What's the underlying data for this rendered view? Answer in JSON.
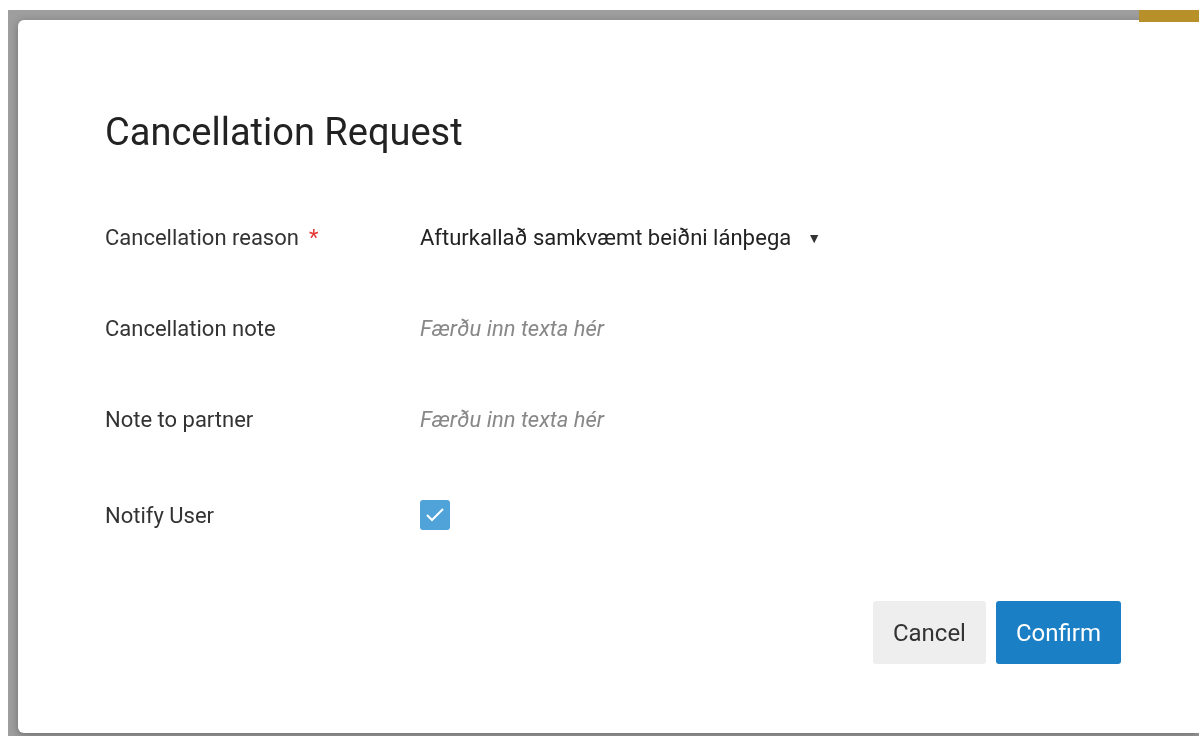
{
  "dialog": {
    "title": "Cancellation Request",
    "fields": [
      {
        "kind": "select",
        "label": "Cancellation reason",
        "required_mark": "*",
        "value": "Afturkallað samkvæmt beiðni lánþega",
        "caret": "▼"
      },
      {
        "kind": "text",
        "label": "Cancellation note",
        "placeholder": "Færðu inn texta hér"
      },
      {
        "kind": "text",
        "label": "Note to partner",
        "placeholder": "Færðu inn texta hér"
      },
      {
        "kind": "checkbox",
        "label": "Notify User",
        "checked": true
      }
    ],
    "buttons": [
      {
        "label": "Cancel",
        "kind": "secondary"
      },
      {
        "label": "Confirm",
        "kind": "primary"
      }
    ]
  }
}
